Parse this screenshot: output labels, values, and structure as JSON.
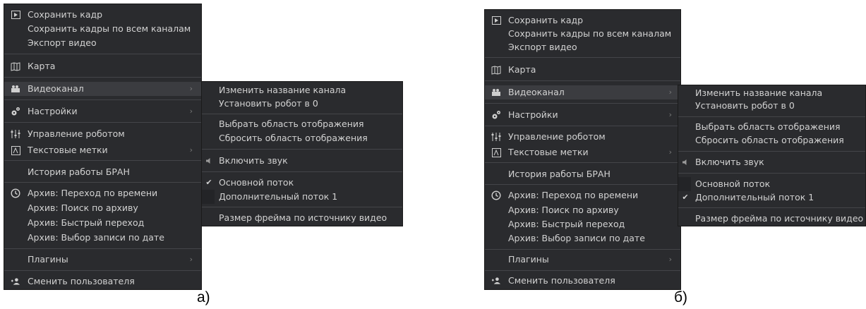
{
  "left": {
    "caption": "а)",
    "main_menu": {
      "save_frame": "Сохранить кадр",
      "save_frames_all": "Сохранить кадры по всем каналам",
      "export_video": "Экспорт видео",
      "map": "Карта",
      "video_channel": "Видеоканал",
      "settings": "Настройки",
      "robot_control": "Управление роботом",
      "text_labels": "Текстовые метки",
      "bran_history": "История работы БРАН",
      "archive_time": "Архив: Переход по времени",
      "archive_search": "Архив: Поиск по архиву",
      "archive_fast": "Архив: Быстрый переход",
      "archive_date": "Архив: Выбор записи по дате",
      "plugins": "Плагины",
      "switch_user": "Сменить пользователя"
    },
    "submenu": {
      "rename_channel": "Изменить название канала",
      "set_robot_zero": "Установить робот в 0",
      "select_area": "Выбрать область отображения",
      "reset_area": "Сбросить область отображения",
      "enable_sound": "Включить звук",
      "main_stream": "Основной поток",
      "extra_stream": "Дополнительный поток 1",
      "frame_size": "Размер фрейма по источнику видео",
      "checked_item": "main_stream"
    }
  },
  "right": {
    "caption": "б)",
    "main_menu": {
      "save_frame": "Сохранить кадр",
      "save_frames_all": "Сохранить кадры по всем каналам",
      "export_video": "Экспорт видео",
      "map": "Карта",
      "video_channel": "Видеоканал",
      "settings": "Настройки",
      "robot_control": "Управление роботом",
      "text_labels": "Текстовые метки",
      "bran_history": "История работы БРАН",
      "archive_time": "Архив: Переход по времени",
      "archive_search": "Архив: Поиск по архиву",
      "archive_fast": "Архив: Быстрый переход",
      "archive_date": "Архив: Выбор записи по дате",
      "plugins": "Плагины",
      "switch_user": "Сменить пользователя"
    },
    "submenu": {
      "rename_channel": "Изменить название канала",
      "set_robot_zero": "Установить робот в 0",
      "select_area": "Выбрать область отображения",
      "reset_area": "Сбросить область отображения",
      "enable_sound": "Включить звук",
      "main_stream": "Основной поток",
      "extra_stream": "Дополнительный поток 1",
      "frame_size": "Размер фрейма по источнику видео",
      "checked_item": "extra_stream"
    }
  },
  "icons": {
    "arrow": "›",
    "check": "✔",
    "sound": "🔈"
  }
}
